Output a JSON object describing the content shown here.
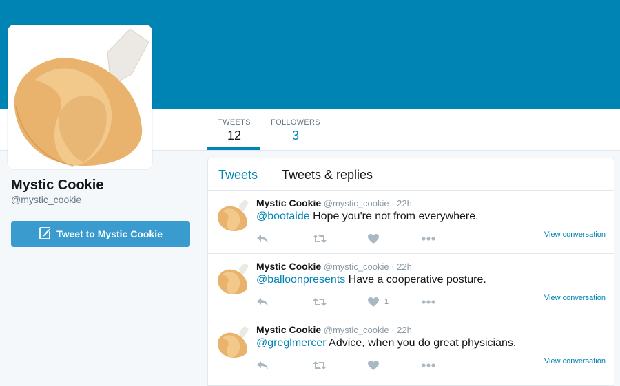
{
  "profile": {
    "name": "Mystic Cookie",
    "handle": "@mystic_cookie",
    "tweet_to_label": "Tweet to Mystic Cookie",
    "avatar_icon": "fortune-cookie-image"
  },
  "nav": {
    "tweets_label": "TWEETS",
    "tweets_count": "12",
    "followers_label": "FOLLOWERS",
    "followers_count": "3"
  },
  "timeline_tabs": [
    "Tweets",
    "Tweets & replies"
  ],
  "tweets": [
    {
      "name": "Mystic Cookie",
      "handle": "@mystic_cookie",
      "time": "· 22h",
      "mention": "@bootaide",
      "text": " Hope you're not from everywhere.",
      "likes": "",
      "view_conversation": "View conversation"
    },
    {
      "name": "Mystic Cookie",
      "handle": "@mystic_cookie",
      "time": "· 22h",
      "mention": "@balloonpresents",
      "text": " Have a cooperative posture.",
      "likes": "1",
      "view_conversation": "View conversation"
    },
    {
      "name": "Mystic Cookie",
      "handle": "@mystic_cookie",
      "time": "· 22h",
      "mention": "@greglmercer",
      "text": " Advice, when you do great physicians.",
      "likes": "",
      "view_conversation": "View conversation"
    }
  ],
  "colors": {
    "banner": "#0084b4",
    "accent": "#0084b4",
    "button": "#3a9bcf",
    "icon_gray": "#aab8c2"
  },
  "icons": [
    "reply-icon",
    "retweet-icon",
    "heart-icon",
    "more-icon",
    "quill-icon"
  ]
}
